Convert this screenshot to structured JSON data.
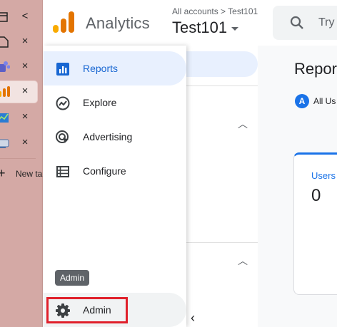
{
  "browser": {
    "tabs": [
      {
        "icon": "window-icon",
        "action": "<"
      },
      {
        "icon": "page-icon",
        "action": "×"
      },
      {
        "icon": "teams-icon",
        "action": "×"
      },
      {
        "icon": "analytics-icon",
        "action": "×",
        "active": true
      },
      {
        "icon": "chart-icon",
        "action": "×"
      },
      {
        "icon": "site-icon",
        "action": "×"
      }
    ],
    "new_tab_label": "New ta"
  },
  "header": {
    "app_name": "Analytics",
    "breadcrumb": "All accounts > Test101",
    "property": "Test101",
    "search_placeholder": "Try"
  },
  "nav": {
    "items": [
      {
        "label": "Reports",
        "icon": "bar-chart-icon",
        "active": true
      },
      {
        "label": "Explore",
        "icon": "explore-icon"
      },
      {
        "label": "Advertising",
        "icon": "advertising-icon"
      },
      {
        "label": "Configure",
        "icon": "configure-icon"
      }
    ],
    "admin_label": "Admin",
    "admin_tooltip": "Admin"
  },
  "main": {
    "title": "Repor",
    "chip_letter": "A",
    "chip_text": "All Us",
    "card_label": "Users",
    "card_value": "0"
  },
  "colors": {
    "accent": "#1a73e8",
    "highlight": "#e0202b",
    "tab_strip": "#d4a9a5"
  }
}
